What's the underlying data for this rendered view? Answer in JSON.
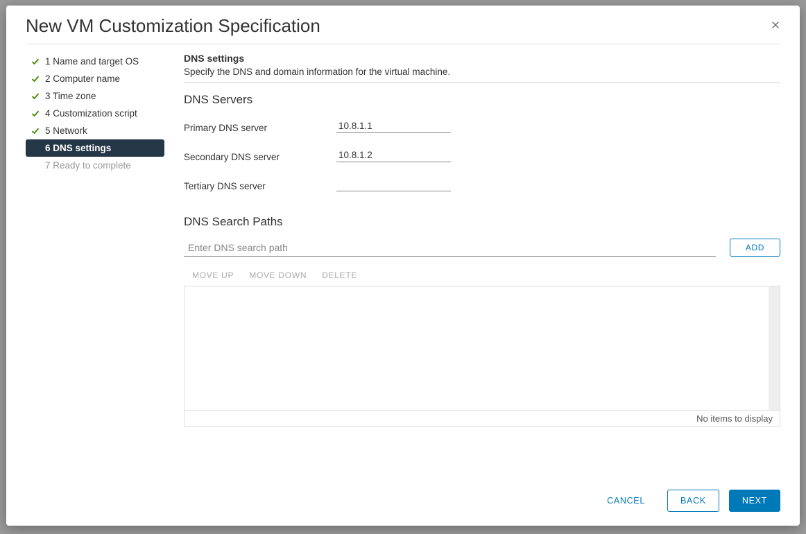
{
  "modal": {
    "title": "New VM Customization Specification",
    "close_aria": "Close"
  },
  "steps": [
    {
      "label": "1 Name and target OS",
      "state": "done"
    },
    {
      "label": "2 Computer name",
      "state": "done"
    },
    {
      "label": "3 Time zone",
      "state": "done"
    },
    {
      "label": "4 Customization script",
      "state": "done"
    },
    {
      "label": "5 Network",
      "state": "done"
    },
    {
      "label": "6 DNS settings",
      "state": "active"
    },
    {
      "label": "7 Ready to complete",
      "state": "future"
    }
  ],
  "section": {
    "title": "DNS settings",
    "description": "Specify the DNS and domain information for the virtual machine."
  },
  "dns_servers": {
    "heading": "DNS Servers",
    "primary_label": "Primary DNS server",
    "primary_value": "10.8.1.1",
    "secondary_label": "Secondary DNS server",
    "secondary_value": "10.8.1.2",
    "tertiary_label": "Tertiary DNS server",
    "tertiary_value": ""
  },
  "dns_search": {
    "heading": "DNS Search Paths",
    "placeholder": "Enter DNS search path",
    "add_label": "ADD",
    "toolbar": {
      "up": "MOVE UP",
      "down": "MOVE DOWN",
      "del": "DELETE"
    },
    "empty_text": "No items to display"
  },
  "footer": {
    "cancel": "CANCEL",
    "back": "BACK",
    "next": "NEXT"
  }
}
